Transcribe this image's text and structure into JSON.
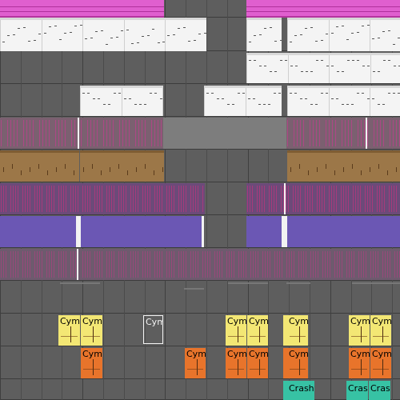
{
  "colors": {
    "background": "#5e5e5e",
    "pink": "#e05fcf",
    "white_clip": "#f4f4f4",
    "mauve": "#7b6070",
    "brown": "#9c7748",
    "purple_stripes": "#6c4a79",
    "indigo": "#6b57b4",
    "yellow": "#f3e774",
    "orange": "#e8742b",
    "teal": "#37c2a4"
  },
  "clips": {
    "cym_label": "Cym",
    "crash_label": "Crash",
    "cras_label": "Cras"
  },
  "tracks": [
    {
      "name": "pink-midi-track"
    },
    {
      "name": "white-midi-track-1"
    },
    {
      "name": "white-midi-track-2"
    },
    {
      "name": "white-midi-track-3"
    },
    {
      "name": "mauve-audio-track"
    },
    {
      "name": "brown-audio-track"
    },
    {
      "name": "purple-audio-track"
    },
    {
      "name": "indigo-audio-track"
    },
    {
      "name": "violet-audio-track"
    },
    {
      "name": "empty-track"
    },
    {
      "name": "cymbal-track-yellow"
    },
    {
      "name": "cymbal-track-orange"
    },
    {
      "name": "crash-track-teal"
    }
  ]
}
